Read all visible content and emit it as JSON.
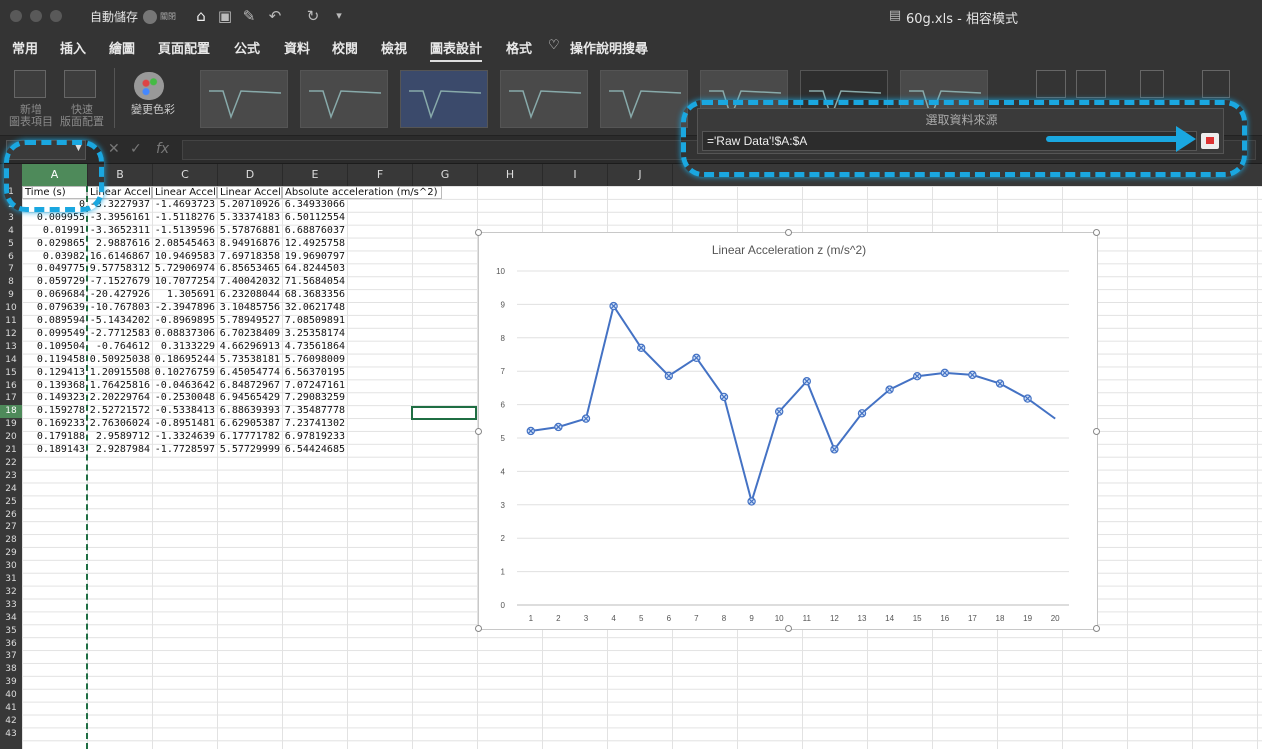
{
  "titlebar": {
    "autosave_label": "自動儲存",
    "autosave_state": "關閉",
    "document_title": "60g.xls  -  相容模式",
    "icons": [
      "home-icon",
      "save-icon",
      "edit-icon",
      "undo-icon",
      "redo-icon",
      "more-icon"
    ]
  },
  "tabs": [
    {
      "label": "常用"
    },
    {
      "label": "插入"
    },
    {
      "label": "繪圖"
    },
    {
      "label": "頁面配置"
    },
    {
      "label": "公式"
    },
    {
      "label": "資料"
    },
    {
      "label": "校閱"
    },
    {
      "label": "檢視"
    },
    {
      "label": "圖表設計",
      "active": true
    },
    {
      "label": "格式"
    },
    {
      "label": "操作說明搜尋"
    }
  ],
  "ribbon": {
    "add_chart_element": "新增\n圖表項目",
    "quick_layout": "快速\n版面配置",
    "change_colors": "變更色彩",
    "style_thumb_title": "Linear Acceleration z (m/s^2)"
  },
  "formula_bar": {
    "namebox": "",
    "fx_label": "fx",
    "formula": ""
  },
  "grid": {
    "columns": [
      "A",
      "B",
      "C",
      "D",
      "E",
      "F",
      "G",
      "H",
      "I",
      "J"
    ],
    "selected_column": "A",
    "row_numbers": [
      1,
      2,
      3,
      4,
      5,
      6,
      7,
      8,
      9,
      10,
      11,
      12,
      13,
      14,
      15,
      16,
      17,
      18,
      19,
      20,
      21,
      22,
      23,
      24,
      25,
      26,
      27,
      28,
      29,
      30,
      31,
      32,
      33,
      34,
      35,
      36,
      37,
      38,
      39,
      40,
      41,
      42,
      43
    ],
    "selected_row": 18,
    "headers": [
      "Time (s)",
      "Linear Accel",
      "Linear Accel",
      "Linear Accel",
      "Absolute acceleration (m/s^2)"
    ],
    "rows": [
      [
        "0",
        "-3.3227937",
        "-1.4693723",
        "5.20710926",
        "6.34933066"
      ],
      [
        "0.009955",
        "-3.3956161",
        "-1.5118276",
        "5.33374183",
        "6.50112554"
      ],
      [
        "0.01991",
        "-3.3652311",
        "-1.5139596",
        "5.57876881",
        "6.68876037"
      ],
      [
        "0.029865",
        "2.9887616",
        "2.08545463",
        "8.94916876",
        "12.4925758"
      ],
      [
        "0.03982",
        "16.6146867",
        "10.9469583",
        "7.69718358",
        "19.9690797"
      ],
      [
        "0.049775",
        "9.57758312",
        "5.72906974",
        "6.85653465",
        "64.8244503"
      ],
      [
        "0.059729",
        "-7.1527679",
        "10.7077254",
        "7.40042032",
        "71.5684054"
      ],
      [
        "0.069684",
        "-20.427926",
        "1.305691",
        "6.23208044",
        "68.3683356"
      ],
      [
        "0.079639",
        "-10.767803",
        "-2.3947896",
        "3.10485756",
        "32.0621748"
      ],
      [
        "0.089594",
        "-5.1434202",
        "-0.8969895",
        "5.78949527",
        "7.08509891"
      ],
      [
        "0.099549",
        "-2.7712583",
        "0.08837306",
        "6.70238409",
        "3.25358174"
      ],
      [
        "0.109504",
        "-0.764612",
        "0.3133229",
        "4.66296913",
        "4.73561864"
      ],
      [
        "0.119458",
        "0.50925038",
        "0.18695244",
        "5.73538181",
        "5.76098009"
      ],
      [
        "0.129413",
        "1.20915508",
        "0.10276759",
        "6.45054774",
        "6.56370195"
      ],
      [
        "0.139368",
        "1.76425816",
        "-0.0463642",
        "6.84872967",
        "7.07247161"
      ],
      [
        "0.149323",
        "2.20229764",
        "-0.2530048",
        "6.94565429",
        "7.29083259"
      ],
      [
        "0.159278",
        "2.52721572",
        "-0.5338413",
        "6.88639393",
        "7.35487778"
      ],
      [
        "0.169233",
        "2.76306024",
        "-0.8951481",
        "6.62905387",
        "7.23741302"
      ],
      [
        "0.179188",
        "2.9589712",
        "-1.3324639",
        "6.17771782",
        "6.97819233"
      ],
      [
        "0.189143",
        "2.9287984",
        "-1.7728597",
        "5.57729999",
        "6.54424685"
      ]
    ]
  },
  "chart_data": {
    "type": "line",
    "title": "Linear Acceleration z (m/s^2)",
    "categories": [
      1,
      2,
      3,
      4,
      5,
      6,
      7,
      8,
      9,
      10,
      11,
      12,
      13,
      14,
      15,
      16,
      17,
      18,
      19,
      20
    ],
    "series": [
      {
        "values": [
          5.21,
          5.33,
          5.58,
          8.95,
          7.7,
          6.86,
          7.4,
          6.23,
          3.1,
          5.79,
          6.7,
          4.66,
          5.74,
          6.45,
          6.85,
          6.95,
          6.89,
          6.63,
          6.18,
          5.58
        ],
        "color": "#4472c4"
      }
    ],
    "markers_on_first": 19,
    "ylim": [
      0,
      10
    ],
    "yticks": [
      0,
      1,
      2,
      3,
      4,
      5,
      6,
      7,
      8,
      9,
      10
    ],
    "grid": true
  },
  "select_source_dialog": {
    "title": "選取資料來源",
    "value": "='Raw Data'!$A:$A"
  },
  "colors": {
    "accent": "#1aa7e0",
    "selection": "#4e8a5a",
    "line": "#4472c4"
  }
}
